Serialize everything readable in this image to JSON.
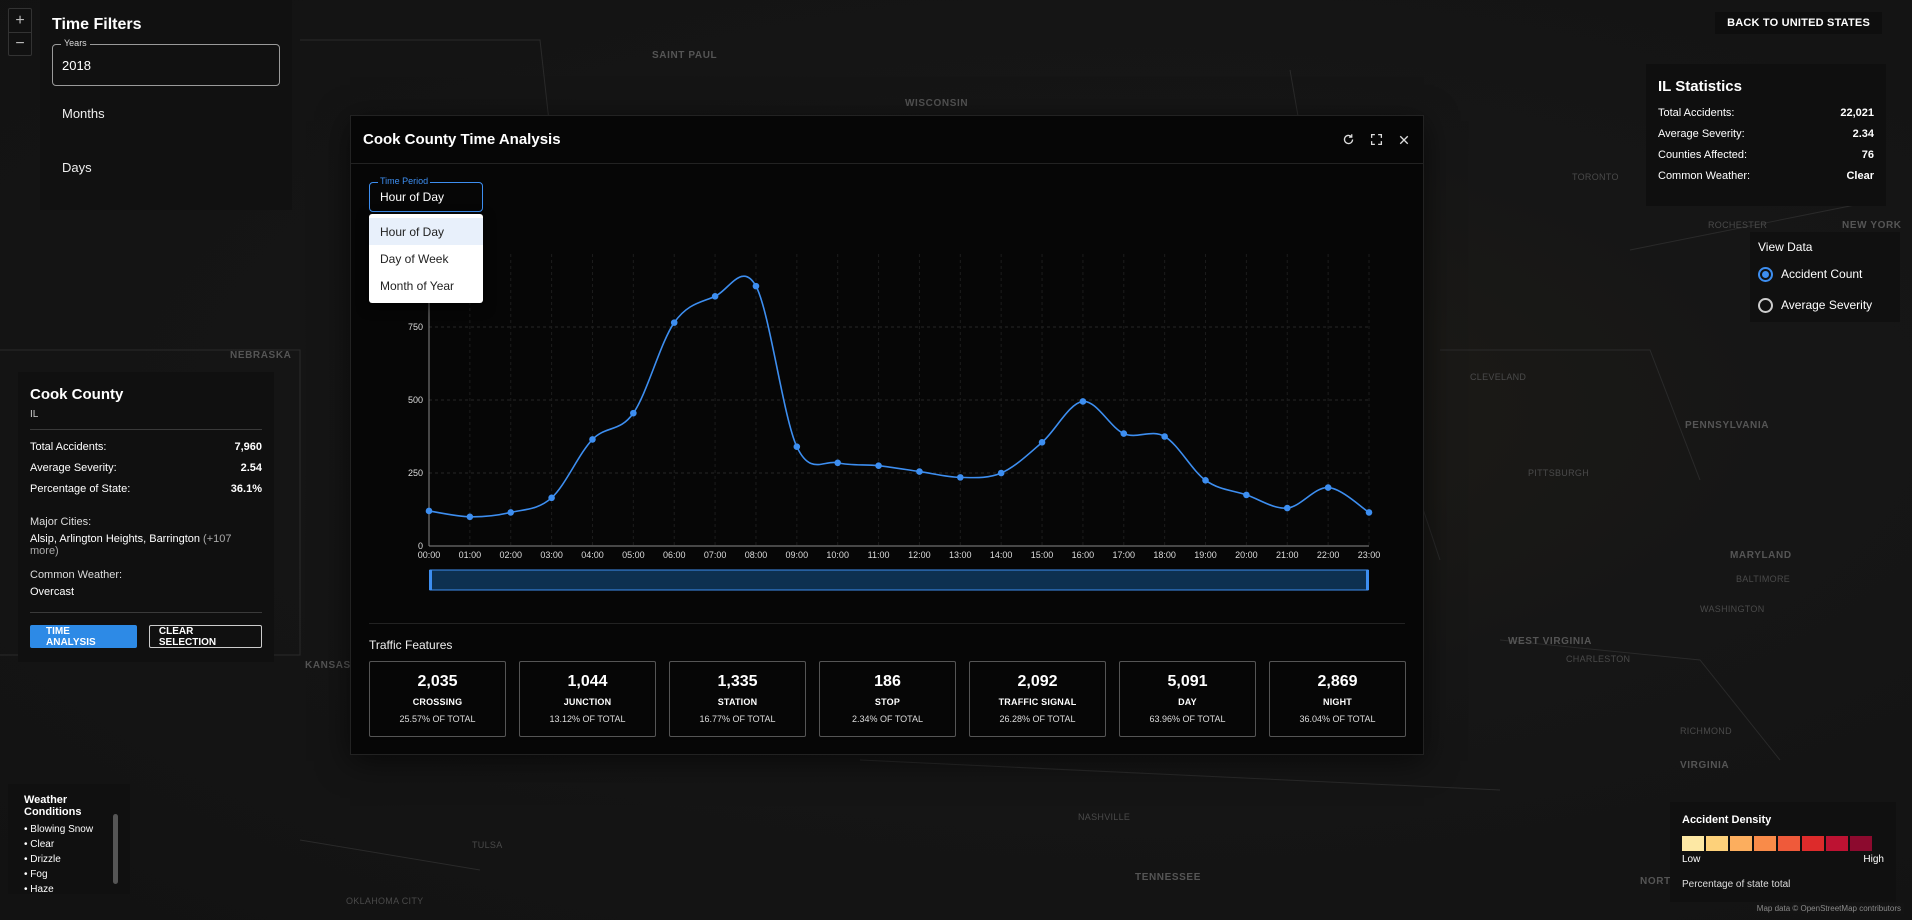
{
  "map": {
    "labels": [
      "SAINT PAUL",
      "WISCONSIN",
      "NEBRASKA",
      "KANSAS",
      "TORONTO",
      "ROCHESTER",
      "NEW YORK",
      "PENNSYLVANIA",
      "PITTSBURGH",
      "WEST VIRGINIA",
      "MARYLAND",
      "BALTIMORE",
      "WASHINGTON",
      "RICHMOND",
      "VIRGINIA",
      "NASHVILLE",
      "TENNESSEE",
      "OKLAHOMA CITY",
      "TULSA",
      "CLEVELAND",
      "CHARLESTON",
      "NORTH"
    ],
    "zoom_in": "+",
    "zoom_out": "−"
  },
  "time_filters": {
    "title": "Time Filters",
    "years_label": "Years",
    "years_value": "2018",
    "months_label": "Months",
    "days_label": "Days"
  },
  "back_button": "BACK TO UNITED STATES",
  "state_stats": {
    "title": "IL Statistics",
    "rows": [
      {
        "label": "Total Accidents:",
        "value": "22,021"
      },
      {
        "label": "Average Severity:",
        "value": "2.34"
      },
      {
        "label": "Counties Affected:",
        "value": "76"
      },
      {
        "label": "Common Weather:",
        "value": "Clear"
      }
    ]
  },
  "view_data": {
    "title": "View Data",
    "options": [
      {
        "label": "Accident Count",
        "selected": true
      },
      {
        "label": "Average Severity",
        "selected": false
      }
    ]
  },
  "county": {
    "name": "Cook County",
    "state": "IL",
    "rows": [
      {
        "label": "Total Accidents:",
        "value": "7,960"
      },
      {
        "label": "Average Severity:",
        "value": "2.54"
      },
      {
        "label": "Percentage of State:",
        "value": "36.1%"
      }
    ],
    "major_cities_label": "Major Cities:",
    "major_cities": "Alsip, Arlington Heights, Barrington",
    "major_cities_more": "(+107 more)",
    "weather_label": "Common Weather:",
    "weather_value": "Overcast",
    "time_analysis_button": "TIME ANALYSIS",
    "clear_button": "CLEAR SELECTION"
  },
  "weather": {
    "title": "Weather Conditions",
    "items": [
      "• Blowing Snow",
      "• Clear",
      "• Drizzle",
      "• Fog",
      "• Haze"
    ]
  },
  "density": {
    "title": "Accident Density",
    "low": "Low",
    "high": "High",
    "subtitle": "Percentage of state total",
    "colors": [
      "#fde8a4",
      "#fdd17a",
      "#fcae5e",
      "#f98b49",
      "#ef5a3a",
      "#dd2b2b",
      "#bd1232",
      "#8c0a2e"
    ]
  },
  "attribution": "Map data © OpenStreetMap contributors",
  "modal": {
    "title": "Cook County Time Analysis",
    "time_period_label": "Time Period",
    "time_period_value": "Hour of Day",
    "options": [
      "Hour of Day",
      "Day of Week",
      "Month of Year"
    ],
    "traffic_title": "Traffic Features",
    "features": [
      {
        "value": "2,035",
        "label": "CROSSING",
        "pct": "25.57% OF TOTAL"
      },
      {
        "value": "1,044",
        "label": "JUNCTION",
        "pct": "13.12% OF TOTAL"
      },
      {
        "value": "1,335",
        "label": "STATION",
        "pct": "16.77% OF TOTAL"
      },
      {
        "value": "186",
        "label": "STOP",
        "pct": "2.34% OF TOTAL"
      },
      {
        "value": "2,092",
        "label": "TRAFFIC SIGNAL",
        "pct": "26.28% OF TOTAL"
      },
      {
        "value": "5,091",
        "label": "DAY",
        "pct": "63.96% OF TOTAL"
      },
      {
        "value": "2,869",
        "label": "NIGHT",
        "pct": "36.04% OF TOTAL"
      }
    ]
  },
  "chart_data": {
    "type": "line",
    "categories": [
      "00:00",
      "01:00",
      "02:00",
      "03:00",
      "04:00",
      "05:00",
      "06:00",
      "07:00",
      "08:00",
      "09:00",
      "10:00",
      "11:00",
      "12:00",
      "13:00",
      "14:00",
      "15:00",
      "16:00",
      "17:00",
      "18:00",
      "19:00",
      "20:00",
      "21:00",
      "22:00",
      "23:00"
    ],
    "values": [
      120,
      100,
      115,
      165,
      365,
      455,
      765,
      855,
      890,
      340,
      285,
      275,
      255,
      235,
      250,
      355,
      495,
      385,
      375,
      225,
      175,
      130,
      200,
      115
    ],
    "ylim": [
      0,
      1000
    ],
    "yticks": [
      0,
      250,
      500,
      750
    ],
    "color": "#3d8ef0",
    "grid": true
  }
}
